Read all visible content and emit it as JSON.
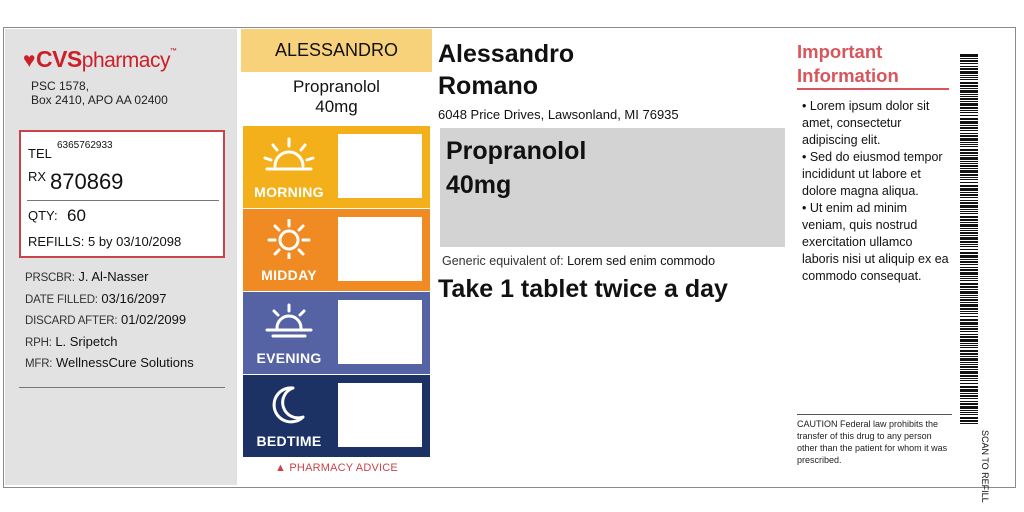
{
  "brand": {
    "logo_text": "CVS",
    "logo_suffix": "pharmacy",
    "address_line1": "PSC 1578,",
    "address_line2": "Box 2410, APO AA 02400",
    "accent_color": "#cc1f27"
  },
  "rx_box": {
    "tel_label": "TEL",
    "tel": "6365762933",
    "rx_label": "RX",
    "rx_number": "870869",
    "qty_label": "QTY:",
    "qty": "60",
    "refills_label": "REFILLS:",
    "refills": "5 by 03/10/2098"
  },
  "details": [
    {
      "label": "PRSCBR:",
      "value": "J. Al-Nasser"
    },
    {
      "label": "DATE FILLED:",
      "value": "03/16/2097"
    },
    {
      "label": "DISCARD AFTER:",
      "value": "01/02/2099"
    },
    {
      "label": "RPH:",
      "value": "L. Sripetch"
    },
    {
      "label": "MFR:",
      "value": "WellnessCure Solutions"
    }
  ],
  "schedule": {
    "patient_first": "ALESSANDRO",
    "drug_line1": "Propranolol",
    "drug_line2": "40mg",
    "slots": [
      {
        "label": "MORNING",
        "icon": "sunrise-icon",
        "color": "#f3b01b"
      },
      {
        "label": "MIDDAY",
        "icon": "sun-icon",
        "color": "#ef8b22"
      },
      {
        "label": "EVENING",
        "icon": "sunset-icon",
        "color": "#5563a4"
      },
      {
        "label": "BEDTIME",
        "icon": "moon-icon",
        "color": "#1d3264"
      }
    ],
    "advice": "▲ PHARMACY ADVICE"
  },
  "patient": {
    "first_name": "Alessandro",
    "last_name": "Romano",
    "address": "6048 Price Drives, Lawsonland, MI 76935"
  },
  "drug": {
    "name": "Propranolol",
    "strength": "40mg",
    "generic_label": "Generic equivalent of:",
    "generic_value": "Lorem sed enim commodo",
    "directions": "Take 1 tablet twice a day"
  },
  "important": {
    "title_line1": "Important",
    "title_line2": "Information",
    "bullets": [
      "• Lorem ipsum dolor sit amet, consectetur adipiscing elit.",
      "• Sed do eiusmod tempor incididunt ut labore et dolore magna aliqua.",
      "• Ut enim ad minim veniam, quis nostrud exercitation ullamco laboris nisi ut aliquip ex ea commodo consequat."
    ],
    "caution": "CAUTION Federal law prohibits the transfer of this drug to any person other than the patient for whom it was prescribed."
  },
  "barcode": {
    "scan_text": "SCAN TO REFILL"
  }
}
